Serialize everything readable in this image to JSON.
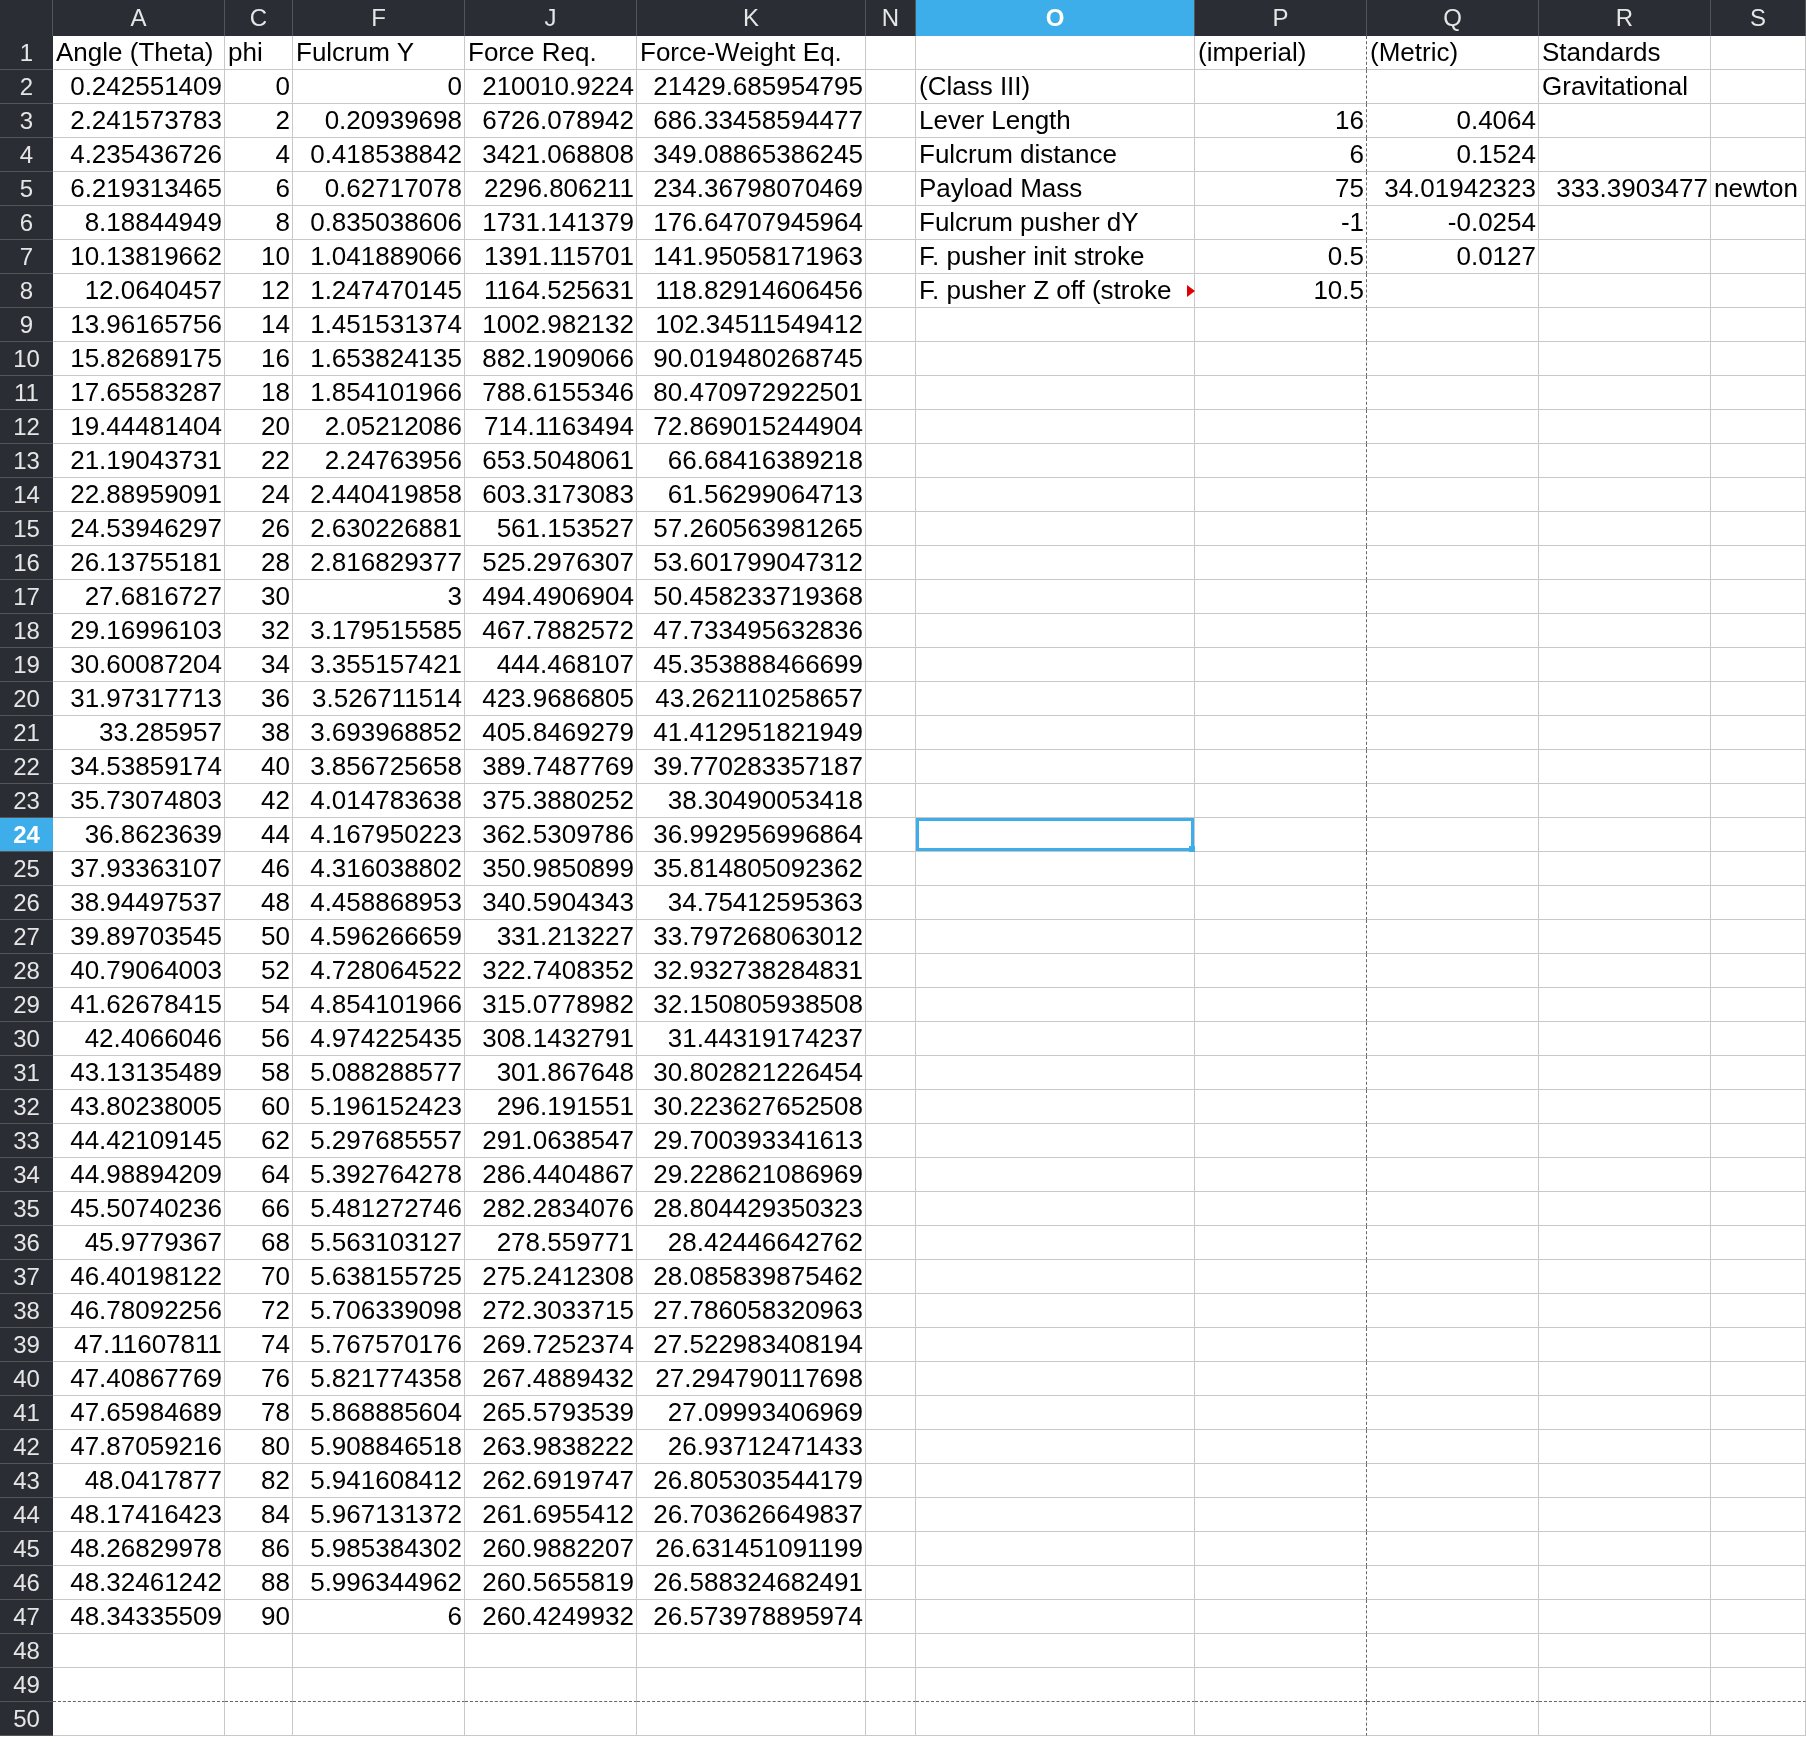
{
  "columns": [
    {
      "label": "A",
      "selected": false
    },
    {
      "label": "C",
      "selected": false
    },
    {
      "label": "F",
      "selected": false
    },
    {
      "label": "J",
      "selected": false
    },
    {
      "label": "K",
      "selected": false
    },
    {
      "label": "N",
      "selected": false
    },
    {
      "label": "O",
      "selected": true
    },
    {
      "label": "P",
      "selected": false
    },
    {
      "label": "Q",
      "selected": false
    },
    {
      "label": "R",
      "selected": false
    },
    {
      "label": "S",
      "selected": false
    }
  ],
  "rows": [
    {
      "number": "1",
      "selected": false,
      "labels": {
        "A": "Angle (Theta)",
        "C": "phi",
        "F": "Fulcrum Y",
        "J": "Force Req.",
        "K": "Force-Weight Eq.",
        "P": "(imperial)",
        "Q": "(Metric)",
        "R": "Standards"
      }
    },
    {
      "number": "2",
      "selected": false,
      "values": {
        "A": "0.242551409",
        "C": "0",
        "F": "0",
        "J": "210010.9224",
        "K": "21429.685954795"
      },
      "labels": {
        "O": "(Class III)",
        "R": "Gravitational"
      }
    },
    {
      "number": "3",
      "selected": false,
      "values": {
        "A": "2.241573783",
        "C": "2",
        "F": "0.20939698",
        "J": "6726.078942",
        "K": "686.33458594477",
        "P": "16",
        "Q": "0.4064"
      },
      "labels": {
        "O": "Lever Length"
      }
    },
    {
      "number": "4",
      "selected": false,
      "values": {
        "A": "4.235436726",
        "C": "4",
        "F": "0.418538842",
        "J": "3421.068808",
        "K": "349.08865386245",
        "P": "6",
        "Q": "0.1524"
      },
      "labels": {
        "O": "Fulcrum distance"
      }
    },
    {
      "number": "5",
      "selected": false,
      "values": {
        "A": "6.219313465",
        "C": "6",
        "F": "0.62717078",
        "J": "2296.806211",
        "K": "234.36798070469",
        "P": "75",
        "Q": "34.01942323",
        "R": "333.3903477"
      },
      "labels": {
        "O": "Payload Mass",
        "S": "newton"
      }
    },
    {
      "number": "6",
      "selected": false,
      "values": {
        "A": "8.18844949",
        "C": "8",
        "F": "0.835038606",
        "J": "1731.141379",
        "K": "176.64707945964",
        "P": "-1",
        "Q": "-0.0254"
      },
      "labels": {
        "O": "Fulcrum pusher dY"
      }
    },
    {
      "number": "7",
      "selected": false,
      "values": {
        "A": "10.13819662",
        "C": "10",
        "F": "1.041889066",
        "J": "1391.115701",
        "K": "141.95058171963",
        "P": "0.5",
        "Q": "0.0127"
      },
      "labels": {
        "O": "F. pusher init stroke"
      }
    },
    {
      "number": "8",
      "selected": false,
      "overflowing": true,
      "values": {
        "A": "12.0640457",
        "C": "12",
        "F": "1.247470145",
        "J": "1164.525631",
        "K": "118.82914606456",
        "P": "10.5"
      },
      "labels": {
        "O": "F. pusher Z off (stroke"
      }
    },
    {
      "number": "9",
      "selected": false,
      "values": {
        "A": "13.96165756",
        "C": "14",
        "F": "1.451531374",
        "J": "1002.982132",
        "K": "102.34511549412"
      }
    },
    {
      "number": "10",
      "selected": false,
      "values": {
        "A": "15.82689175",
        "C": "16",
        "F": "1.653824135",
        "J": "882.1909066",
        "K": "90.019480268745"
      }
    },
    {
      "number": "11",
      "selected": false,
      "values": {
        "A": "17.65583287",
        "C": "18",
        "F": "1.854101966",
        "J": "788.6155346",
        "K": "80.470972922501"
      }
    },
    {
      "number": "12",
      "selected": false,
      "values": {
        "A": "19.44481404",
        "C": "20",
        "F": "2.05212086",
        "J": "714.1163494",
        "K": "72.869015244904"
      }
    },
    {
      "number": "13",
      "selected": false,
      "values": {
        "A": "21.19043731",
        "C": "22",
        "F": "2.24763956",
        "J": "653.5048061",
        "K": "66.68416389218"
      }
    },
    {
      "number": "14",
      "selected": false,
      "values": {
        "A": "22.88959091",
        "C": "24",
        "F": "2.440419858",
        "J": "603.3173083",
        "K": "61.56299064713"
      }
    },
    {
      "number": "15",
      "selected": false,
      "values": {
        "A": "24.53946297",
        "C": "26",
        "F": "2.630226881",
        "J": "561.153527",
        "K": "57.260563981265"
      }
    },
    {
      "number": "16",
      "selected": false,
      "values": {
        "A": "26.13755181",
        "C": "28",
        "F": "2.816829377",
        "J": "525.2976307",
        "K": "53.601799047312"
      }
    },
    {
      "number": "17",
      "selected": false,
      "values": {
        "A": "27.6816727",
        "C": "30",
        "F": "3",
        "J": "494.4906904",
        "K": "50.458233719368"
      }
    },
    {
      "number": "18",
      "selected": false,
      "values": {
        "A": "29.16996103",
        "C": "32",
        "F": "3.179515585",
        "J": "467.7882572",
        "K": "47.733495632836"
      }
    },
    {
      "number": "19",
      "selected": false,
      "values": {
        "A": "30.60087204",
        "C": "34",
        "F": "3.355157421",
        "J": "444.468107",
        "K": "45.353888466699"
      }
    },
    {
      "number": "20",
      "selected": false,
      "values": {
        "A": "31.97317713",
        "C": "36",
        "F": "3.526711514",
        "J": "423.9686805",
        "K": "43.262110258657"
      }
    },
    {
      "number": "21",
      "selected": false,
      "values": {
        "A": "33.285957",
        "C": "38",
        "F": "3.693968852",
        "J": "405.8469279",
        "K": "41.412951821949"
      }
    },
    {
      "number": "22",
      "selected": false,
      "values": {
        "A": "34.53859174",
        "C": "40",
        "F": "3.856725658",
        "J": "389.7487769",
        "K": "39.770283357187"
      }
    },
    {
      "number": "23",
      "selected": false,
      "values": {
        "A": "35.73074803",
        "C": "42",
        "F": "4.014783638",
        "J": "375.3880252",
        "K": "38.30490053418"
      }
    },
    {
      "number": "24",
      "selected": true,
      "values": {
        "A": "36.8623639",
        "C": "44",
        "F": "4.167950223",
        "J": "362.5309786",
        "K": "36.992956996864"
      }
    },
    {
      "number": "25",
      "selected": false,
      "values": {
        "A": "37.93363107",
        "C": "46",
        "F": "4.316038802",
        "J": "350.9850899",
        "K": "35.814805092362"
      }
    },
    {
      "number": "26",
      "selected": false,
      "values": {
        "A": "38.94497537",
        "C": "48",
        "F": "4.458868953",
        "J": "340.5904343",
        "K": "34.75412595363"
      }
    },
    {
      "number": "27",
      "selected": false,
      "values": {
        "A": "39.89703545",
        "C": "50",
        "F": "4.596266659",
        "J": "331.213227",
        "K": "33.797268063012"
      }
    },
    {
      "number": "28",
      "selected": false,
      "values": {
        "A": "40.79064003",
        "C": "52",
        "F": "4.728064522",
        "J": "322.7408352",
        "K": "32.932738284831"
      }
    },
    {
      "number": "29",
      "selected": false,
      "values": {
        "A": "41.62678415",
        "C": "54",
        "F": "4.854101966",
        "J": "315.0778982",
        "K": "32.150805938508"
      }
    },
    {
      "number": "30",
      "selected": false,
      "values": {
        "A": "42.4066046",
        "C": "56",
        "F": "4.974225435",
        "J": "308.1432791",
        "K": "31.44319174237"
      }
    },
    {
      "number": "31",
      "selected": false,
      "values": {
        "A": "43.13135489",
        "C": "58",
        "F": "5.088288577",
        "J": "301.867648",
        "K": "30.802821226454"
      }
    },
    {
      "number": "32",
      "selected": false,
      "values": {
        "A": "43.80238005",
        "C": "60",
        "F": "5.196152423",
        "J": "296.191551",
        "K": "30.223627652508"
      }
    },
    {
      "number": "33",
      "selected": false,
      "values": {
        "A": "44.42109145",
        "C": "62",
        "F": "5.297685557",
        "J": "291.0638547",
        "K": "29.700393341613"
      }
    },
    {
      "number": "34",
      "selected": false,
      "values": {
        "A": "44.98894209",
        "C": "64",
        "F": "5.392764278",
        "J": "286.4404867",
        "K": "29.228621086969"
      }
    },
    {
      "number": "35",
      "selected": false,
      "values": {
        "A": "45.50740236",
        "C": "66",
        "F": "5.481272746",
        "J": "282.2834076",
        "K": "28.804429350323"
      }
    },
    {
      "number": "36",
      "selected": false,
      "values": {
        "A": "45.9779367",
        "C": "68",
        "F": "5.563103127",
        "J": "278.559771",
        "K": "28.42446642762"
      }
    },
    {
      "number": "37",
      "selected": false,
      "values": {
        "A": "46.40198122",
        "C": "70",
        "F": "5.638155725",
        "J": "275.2412308",
        "K": "28.085839875462"
      }
    },
    {
      "number": "38",
      "selected": false,
      "values": {
        "A": "46.78092256",
        "C": "72",
        "F": "5.706339098",
        "J": "272.3033715",
        "K": "27.786058320963"
      }
    },
    {
      "number": "39",
      "selected": false,
      "values": {
        "A": "47.11607811",
        "C": "74",
        "F": "5.767570176",
        "J": "269.7252374",
        "K": "27.522983408194"
      }
    },
    {
      "number": "40",
      "selected": false,
      "values": {
        "A": "47.40867769",
        "C": "76",
        "F": "5.821774358",
        "J": "267.4889432",
        "K": "27.294790117698"
      }
    },
    {
      "number": "41",
      "selected": false,
      "values": {
        "A": "47.65984689",
        "C": "78",
        "F": "5.868885604",
        "J": "265.5793539",
        "K": "27.09993406969"
      }
    },
    {
      "number": "42",
      "selected": false,
      "values": {
        "A": "47.87059216",
        "C": "80",
        "F": "5.908846518",
        "J": "263.9838222",
        "K": "26.93712471433"
      }
    },
    {
      "number": "43",
      "selected": false,
      "values": {
        "A": "48.0417877",
        "C": "82",
        "F": "5.941608412",
        "J": "262.6919747",
        "K": "26.805303544179"
      }
    },
    {
      "number": "44",
      "selected": false,
      "values": {
        "A": "48.17416423",
        "C": "84",
        "F": "5.967131372",
        "J": "261.6955412",
        "K": "26.703626649837"
      }
    },
    {
      "number": "45",
      "selected": false,
      "values": {
        "A": "48.26829978",
        "C": "86",
        "F": "5.985384302",
        "J": "260.9882207",
        "K": "26.631451091199"
      }
    },
    {
      "number": "46",
      "selected": false,
      "values": {
        "A": "48.32461242",
        "C": "88",
        "F": "5.996344962",
        "J": "260.5655819",
        "K": "26.588324682491"
      }
    },
    {
      "number": "47",
      "selected": false,
      "values": {
        "A": "48.34335509",
        "C": "90",
        "F": "6",
        "J": "260.4249932",
        "K": "26.573978895974"
      }
    },
    {
      "number": "48",
      "selected": false
    },
    {
      "number": "49",
      "selected": false
    },
    {
      "number": "50",
      "selected": false
    }
  ]
}
